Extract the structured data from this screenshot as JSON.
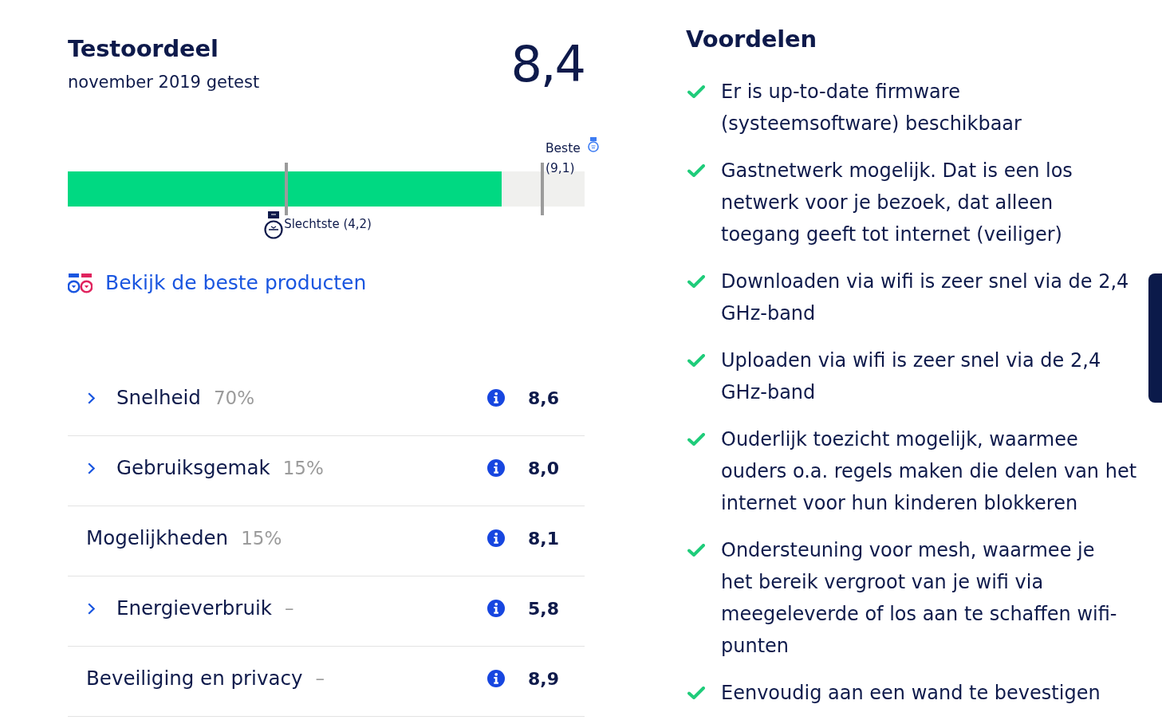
{
  "verdict": {
    "title": "Testoordeel",
    "subtitle": "november 2019 getest",
    "score": "8,4"
  },
  "score_bar": {
    "level": 0.84,
    "worst": {
      "label": "Slechtste (4,2)",
      "level": 0.42
    },
    "best": {
      "label": "Beste (9,1)",
      "level": 0.915
    }
  },
  "best_products_link": {
    "label": "Bekijk de beste producten"
  },
  "criteria": [
    {
      "label": "Snelheid",
      "weight": "70%",
      "score": "8,6",
      "expandable": true
    },
    {
      "label": "Gebruiksgemak",
      "weight": "15%",
      "score": "8,0",
      "expandable": true
    },
    {
      "label": "Mogelijkheden",
      "weight": "15%",
      "score": "8,1",
      "expandable": false
    },
    {
      "label": "Energieverbruik",
      "weight": "–",
      "score": "5,8",
      "expandable": true
    },
    {
      "label": "Beveiliging en privacy",
      "weight": "–",
      "score": "8,9",
      "expandable": false
    }
  ],
  "pros": {
    "title": "Voordelen",
    "items": [
      "Er is up-to-date firmware\n(systeemsoftware) beschikbaar",
      "Gastnetwerk mogelijk. Dat is een los\nnetwerk voor je bezoek, dat alleen\ntoegang geeft tot internet (veiliger)",
      "Downloaden via wifi is zeer snel via de 2,4\nGHz-band",
      "Uploaden via wifi is zeer snel via de 2,4\nGHz-band",
      "Ouderlijk toezicht mogelijk, waarmee\nouders o.a. regels maken die delen van het\ninternet voor hun kinderen blokkeren",
      "Ondersteuning voor mesh, waarmee je\nhet bereik vergroot van je wifi via\nmeegeleverde of los aan te schaffen wifi-punten",
      "Eenvoudig aan een wand te bevestigen"
    ]
  }
}
